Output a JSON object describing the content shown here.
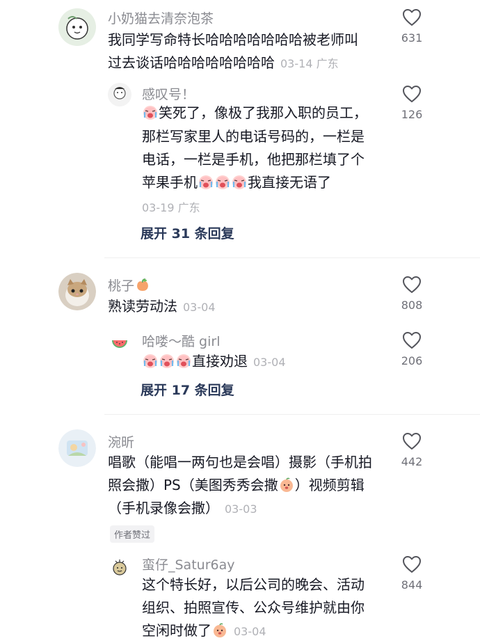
{
  "comments": [
    {
      "user": "小奶猫去清奈泡茶",
      "lines": [
        "我同学写命特长哈哈哈哈哈哈哈被老师叫",
        "过去谈话哈哈哈哈哈哈哈哈"
      ],
      "date": "03-14",
      "location": "广东",
      "likes": "631",
      "reply": {
        "user": "感叹号！",
        "line1_text": "笑死了，像极了我那入职的员工，",
        "line2": "那栏写家里人的电话号码的，一栏是",
        "line3": "电话，一栏是手机，他把那栏填了个",
        "line4_pre": "苹果手机",
        "line4_post": "我直接无语了",
        "date": "03-19",
        "location": "广东",
        "likes": "126"
      },
      "expand_label": "展开 31 条回复"
    },
    {
      "user": "桃子",
      "text": "熟读劳动法",
      "date": "03-04",
      "likes": "808",
      "reply": {
        "user": "哈喽～酷 girl",
        "text": "直接劝退",
        "date": "03-04",
        "likes": "206"
      },
      "expand_label": "展开 17 条回复"
    },
    {
      "user": "涴昕",
      "line1": "唱歌（能唱一两句也是会唱）摄影（手机拍",
      "line2_pre": "照会撒）PS（美图秀秀会撒",
      "line2_post": "）视频剪辑",
      "line3": "（手机录像会撒）",
      "date": "03-03",
      "likes": "442",
      "author_badge": "作者赞过",
      "reply": {
        "user": "蛮仔_Satur6ay",
        "line1": "这个特长好，以后公司的晚会、活动",
        "line2": "组织、拍照宣传、公众号维护就由你",
        "line3": "空闲时做了",
        "date": "03-04",
        "likes": "844"
      }
    }
  ],
  "icons": {
    "like": "heart-outline-icon",
    "cry": "crying-face-emoji",
    "peach": "peach-emoji",
    "watermelon": "watermelon-icon"
  },
  "colors": {
    "username": "#8a8b91",
    "text": "#161823",
    "meta": "#b0b1b6",
    "expand": "#2b3a5a"
  }
}
